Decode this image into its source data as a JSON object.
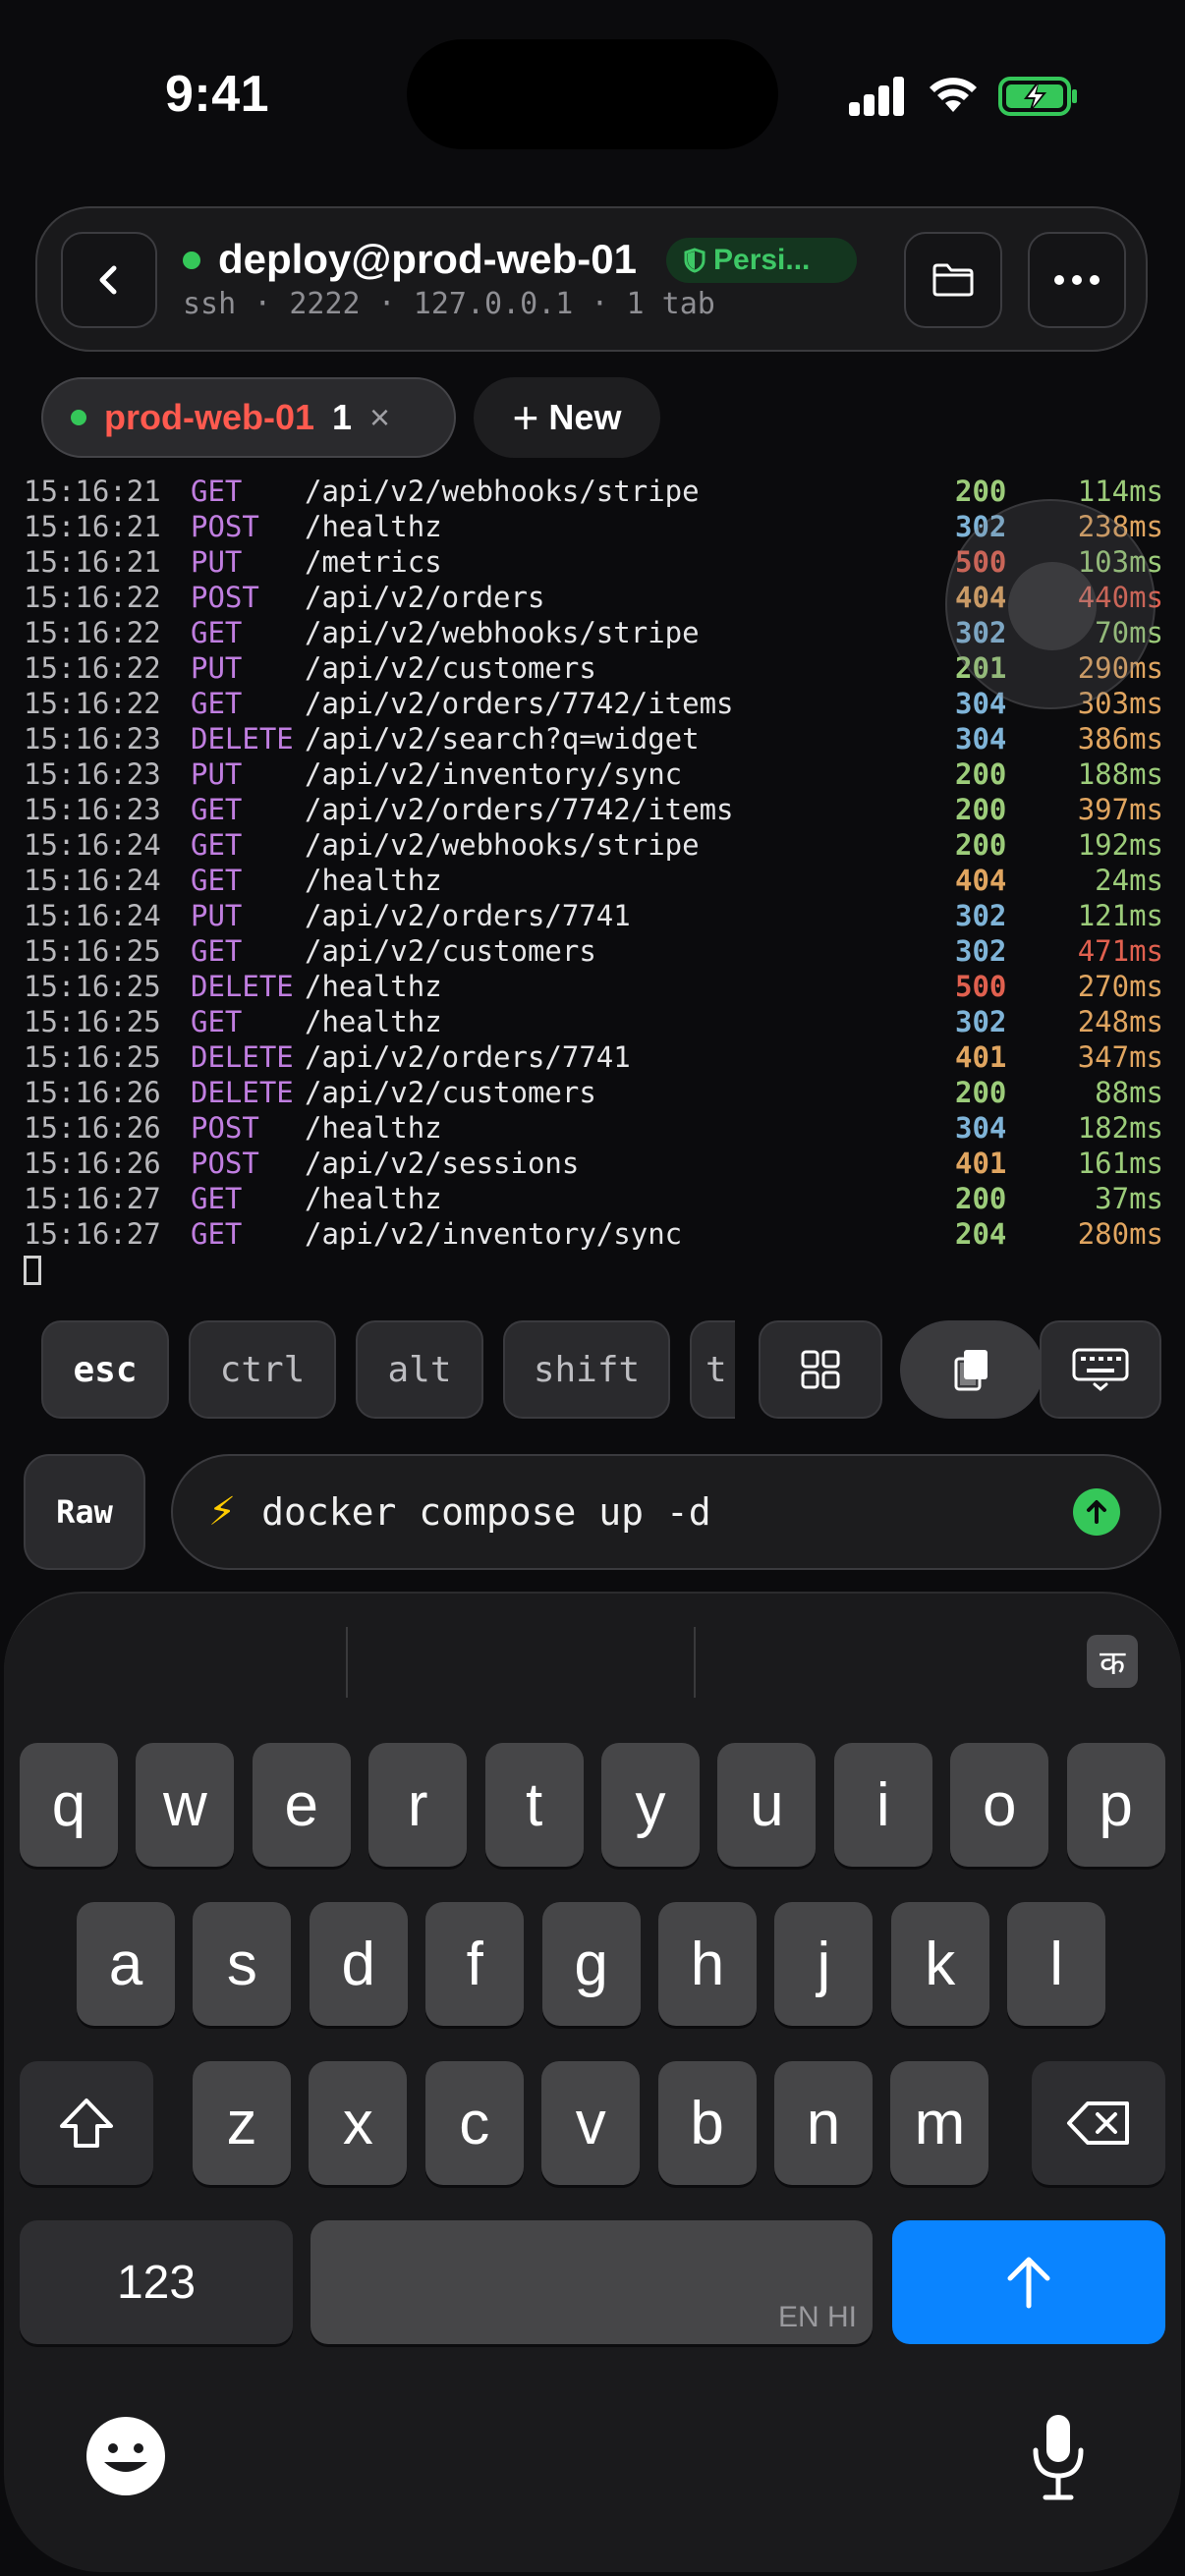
{
  "status_bar": {
    "time": "9:41"
  },
  "header": {
    "host": "deploy@prod-web-01",
    "badge": "Persi...",
    "subtitle": "ssh · 2222 · 127.0.0.1 · 1 tab"
  },
  "tabs": {
    "active": {
      "name": "prod-web-01",
      "count": "1",
      "close": "×"
    },
    "new_label": "New"
  },
  "log": [
    {
      "time": "15:16:21",
      "method": "GET",
      "path": "/api/v2/webhooks/stripe",
      "status": "200",
      "ms": "114ms"
    },
    {
      "time": "15:16:21",
      "method": "POST",
      "path": "/healthz",
      "status": "302",
      "ms": "238ms"
    },
    {
      "time": "15:16:21",
      "method": "PUT",
      "path": "/metrics",
      "status": "500",
      "ms": "103ms"
    },
    {
      "time": "15:16:22",
      "method": "POST",
      "path": "/api/v2/orders",
      "status": "404",
      "ms": "440ms"
    },
    {
      "time": "15:16:22",
      "method": "GET",
      "path": "/api/v2/webhooks/stripe",
      "status": "302",
      "ms": "70ms"
    },
    {
      "time": "15:16:22",
      "method": "PUT",
      "path": "/api/v2/customers",
      "status": "201",
      "ms": "290ms"
    },
    {
      "time": "15:16:22",
      "method": "GET",
      "path": "/api/v2/orders/7742/items",
      "status": "304",
      "ms": "303ms"
    },
    {
      "time": "15:16:23",
      "method": "DELETE",
      "path": "/api/v2/search?q=widget",
      "status": "304",
      "ms": "386ms"
    },
    {
      "time": "15:16:23",
      "method": "PUT",
      "path": "/api/v2/inventory/sync",
      "status": "200",
      "ms": "188ms"
    },
    {
      "time": "15:16:23",
      "method": "GET",
      "path": "/api/v2/orders/7742/items",
      "status": "200",
      "ms": "397ms"
    },
    {
      "time": "15:16:24",
      "method": "GET",
      "path": "/api/v2/webhooks/stripe",
      "status": "200",
      "ms": "192ms"
    },
    {
      "time": "15:16:24",
      "method": "GET",
      "path": "/healthz",
      "status": "404",
      "ms": "24ms"
    },
    {
      "time": "15:16:24",
      "method": "PUT",
      "path": "/api/v2/orders/7741",
      "status": "302",
      "ms": "121ms"
    },
    {
      "time": "15:16:25",
      "method": "GET",
      "path": "/api/v2/customers",
      "status": "302",
      "ms": "471ms"
    },
    {
      "time": "15:16:25",
      "method": "DELETE",
      "path": "/healthz",
      "status": "500",
      "ms": "270ms"
    },
    {
      "time": "15:16:25",
      "method": "GET",
      "path": "/healthz",
      "status": "302",
      "ms": "248ms"
    },
    {
      "time": "15:16:25",
      "method": "DELETE",
      "path": "/api/v2/orders/7741",
      "status": "401",
      "ms": "347ms"
    },
    {
      "time": "15:16:26",
      "method": "DELETE",
      "path": "/api/v2/customers",
      "status": "200",
      "ms": "88ms"
    },
    {
      "time": "15:16:26",
      "method": "POST",
      "path": "/healthz",
      "status": "304",
      "ms": "182ms"
    },
    {
      "time": "15:16:26",
      "method": "POST",
      "path": "/api/v2/sessions",
      "status": "401",
      "ms": "161ms"
    },
    {
      "time": "15:16:27",
      "method": "GET",
      "path": "/healthz",
      "status": "200",
      "ms": "37ms"
    },
    {
      "time": "15:16:27",
      "method": "GET",
      "path": "/api/v2/inventory/sync",
      "status": "204",
      "ms": "280ms"
    }
  ],
  "colors": {
    "status_2xx": "#9ccc7a",
    "status_3xx": "#7fb4d8",
    "status_4xx": "#e0a560",
    "status_5xx": "#e0604f",
    "ms_fast": "#9ccc7a",
    "ms_mid": "#e0a560",
    "ms_slow": "#e0604f",
    "accent": "#0a84ff",
    "online": "#35c759"
  },
  "keybar": {
    "keys": [
      "esc",
      "ctrl",
      "alt",
      "shift",
      "t"
    ]
  },
  "input": {
    "mode": "Raw",
    "value": "docker compose up -d"
  },
  "keyboard": {
    "row1": [
      "q",
      "w",
      "e",
      "r",
      "t",
      "y",
      "u",
      "i",
      "o",
      "p"
    ],
    "row2": [
      "a",
      "s",
      "d",
      "f",
      "g",
      "h",
      "j",
      "k",
      "l"
    ],
    "row3": [
      "z",
      "x",
      "c",
      "v",
      "b",
      "n",
      "m"
    ],
    "numbers_label": "123",
    "space_hint": "EN HI",
    "lang_key": "क"
  }
}
